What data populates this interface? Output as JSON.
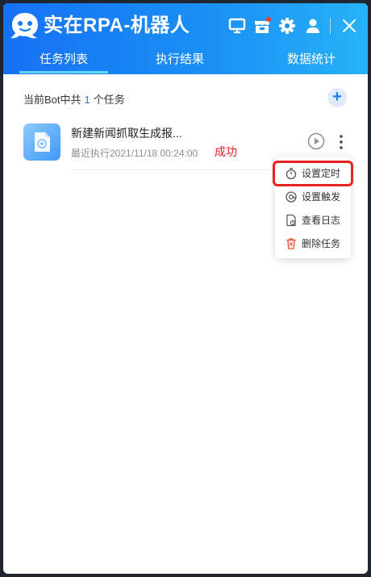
{
  "app": {
    "title": "实在RPA-机器人"
  },
  "tabs": [
    {
      "label": "任务列表",
      "active": true
    },
    {
      "label": "执行结果",
      "active": false
    },
    {
      "label": "数据统计",
      "active": false
    }
  ],
  "summary": {
    "prefix": "当前Bot中共",
    "count": "1",
    "suffix": "个任务"
  },
  "task": {
    "name": "新建新闻抓取生成报...",
    "last_run": "最近执行2021/11/18 00:24:00",
    "status": "成功"
  },
  "menu": {
    "items": [
      {
        "label": "设置定时",
        "icon": "timer-icon"
      },
      {
        "label": "设置触发",
        "icon": "trigger-icon"
      },
      {
        "label": "查看日志",
        "icon": "log-icon"
      },
      {
        "label": "删除任务",
        "icon": "trash-icon"
      }
    ]
  },
  "colors": {
    "accent": "#1f7bf4",
    "status_success": "#e5202e",
    "highlight": "#e8231d"
  }
}
